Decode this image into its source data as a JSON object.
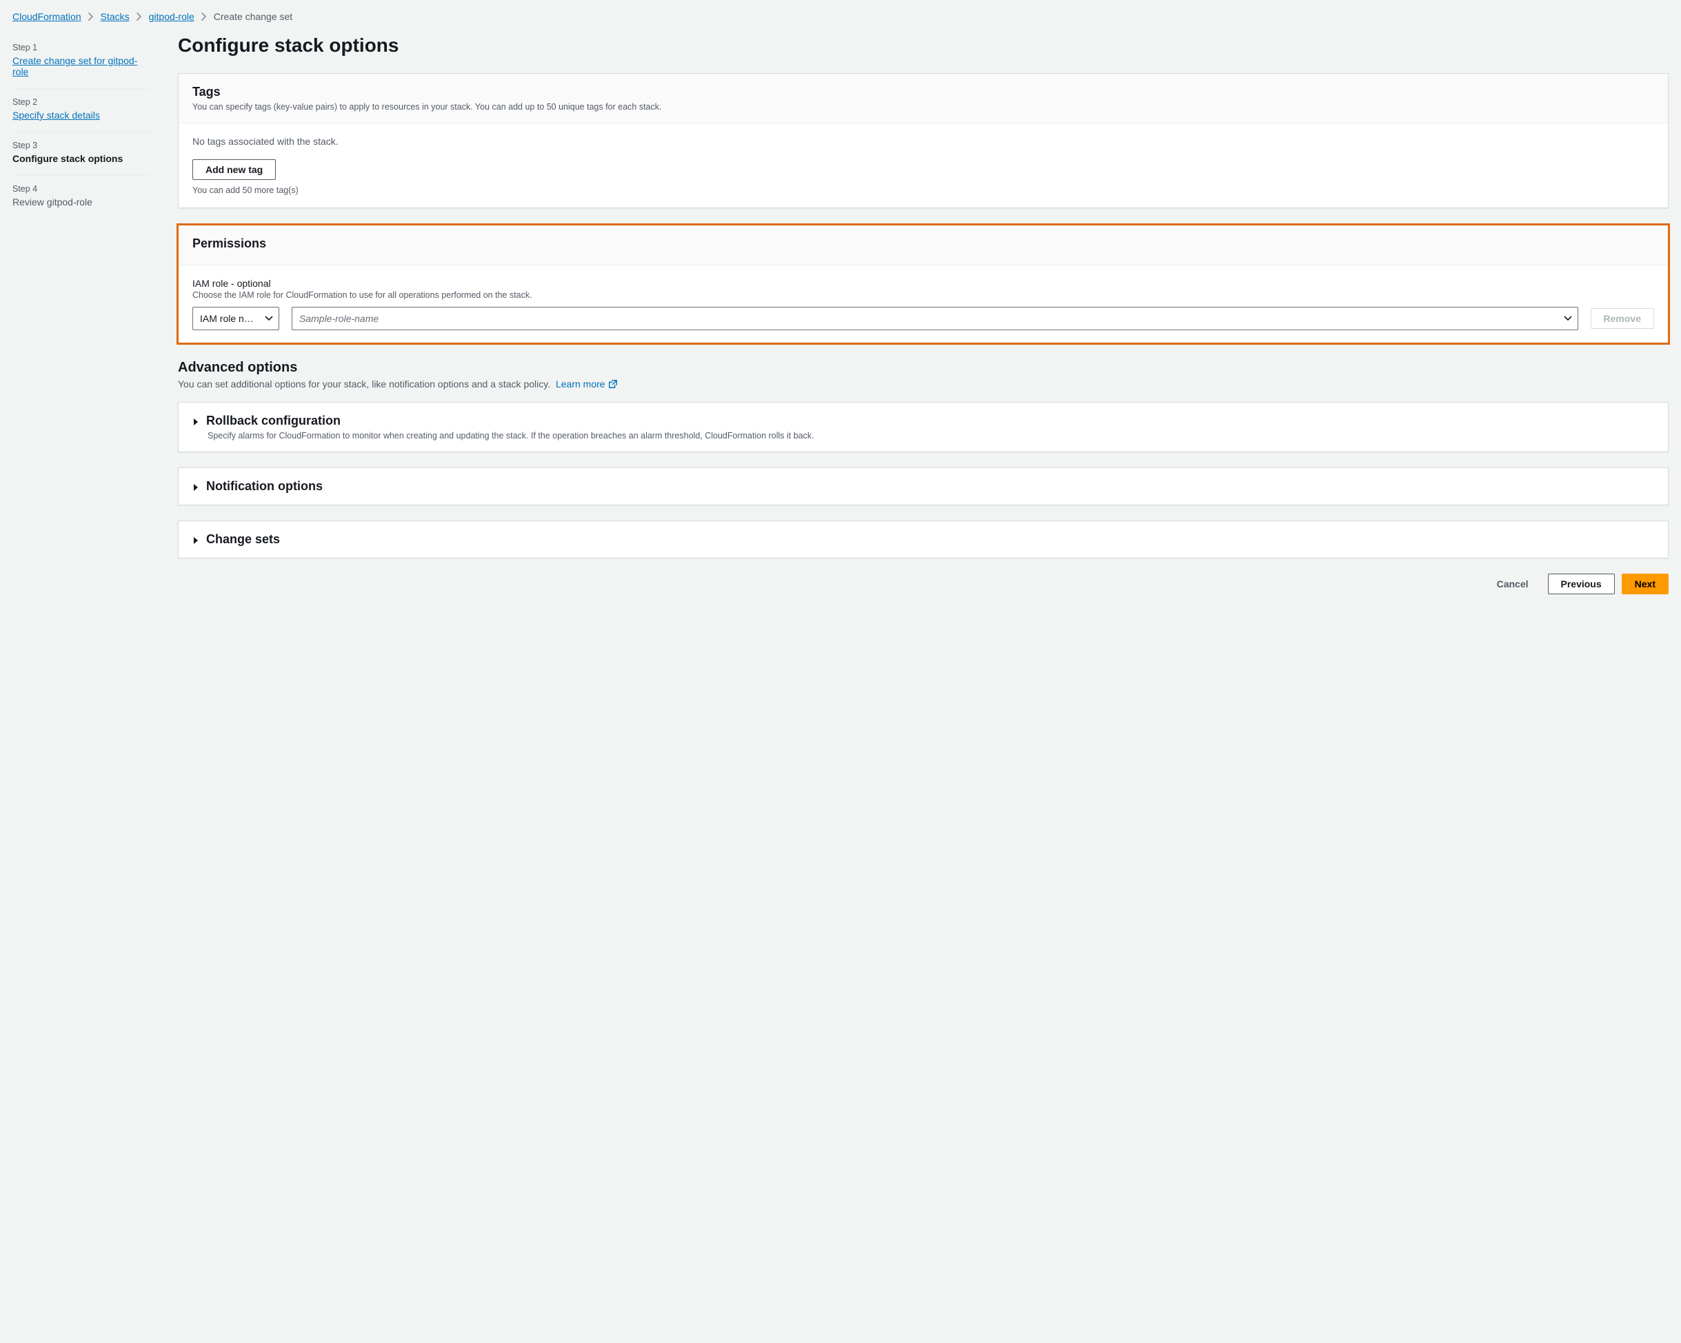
{
  "breadcrumb": {
    "cloudformation": "CloudFormation",
    "stacks": "Stacks",
    "role": "gitpod-role",
    "current": "Create change set"
  },
  "steps": [
    {
      "label": "Step 1",
      "title": "Create change set for gitpod-role",
      "state": "link"
    },
    {
      "label": "Step 2",
      "title": "Specify stack details",
      "state": "link"
    },
    {
      "label": "Step 3",
      "title": "Configure stack options",
      "state": "current"
    },
    {
      "label": "Step 4",
      "title": "Review gitpod-role",
      "state": "future"
    }
  ],
  "page_title": "Configure stack options",
  "tags": {
    "heading": "Tags",
    "desc": "You can specify tags (key-value pairs) to apply to resources in your stack. You can add up to 50 unique tags for each stack.",
    "empty": "No tags associated with the stack.",
    "add_button": "Add new tag",
    "hint": "You can add 50 more tag(s)"
  },
  "permissions": {
    "heading": "Permissions",
    "field_label": "IAM role - optional",
    "field_desc": "Choose the IAM role for CloudFormation to use for all operations performed on the stack.",
    "type_select": "IAM role n…",
    "role_placeholder": "Sample-role-name",
    "remove": "Remove"
  },
  "advanced": {
    "heading": "Advanced options",
    "desc": "You can set additional options for your stack, like notification options and a stack policy.",
    "learn_more": "Learn more"
  },
  "rollback": {
    "heading": "Rollback configuration",
    "desc": "Specify alarms for CloudFormation to monitor when creating and updating the stack. If the operation breaches an alarm threshold, CloudFormation rolls it back."
  },
  "notification": {
    "heading": "Notification options"
  },
  "change_sets": {
    "heading": "Change sets"
  },
  "actions": {
    "cancel": "Cancel",
    "previous": "Previous",
    "next": "Next"
  }
}
